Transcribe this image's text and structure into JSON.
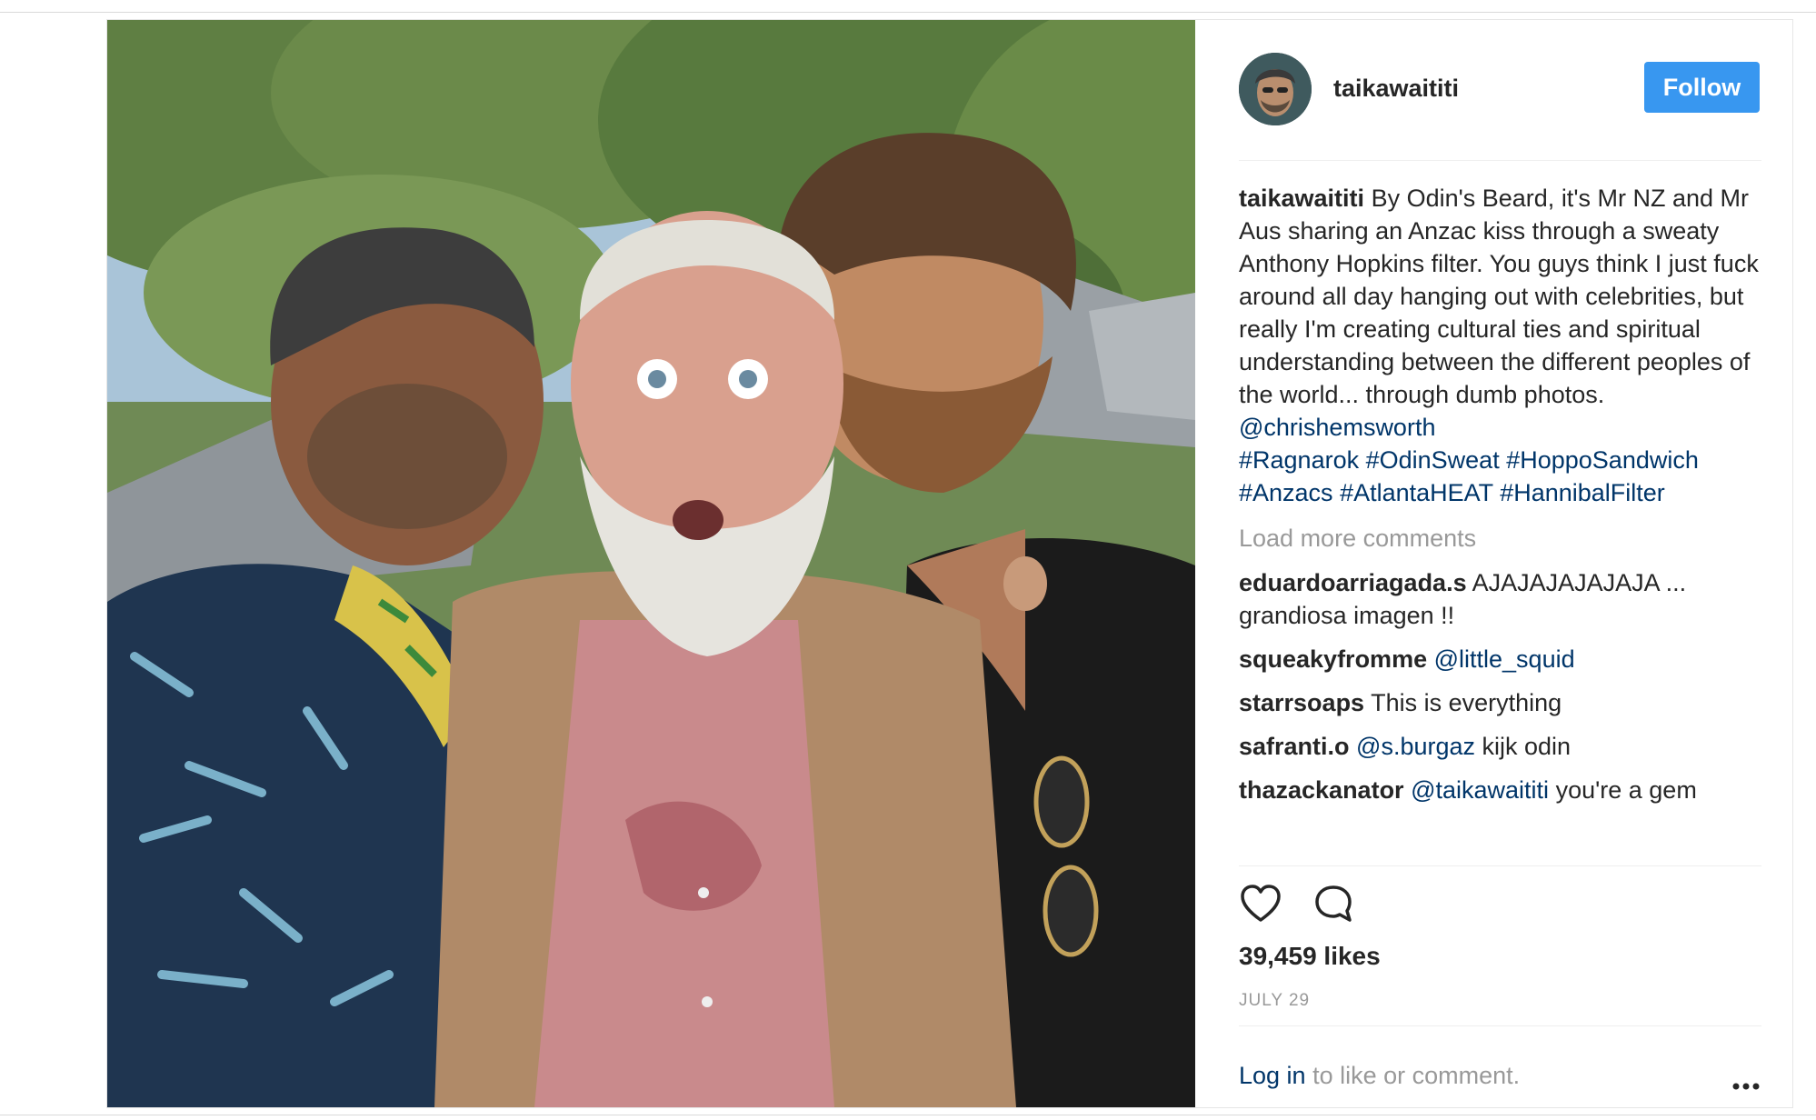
{
  "post": {
    "username": "taikawaititi",
    "follow_label": "Follow",
    "caption": {
      "username": "taikawaititi",
      "text": "By Odin's Beard, it's Mr NZ and Mr Aus sharing an Anzac kiss through a sweaty Anthony Hopkins filter. You guys think I just fuck around all day hanging out with celebrities, but really I'm creating cultural ties and spiritual understanding between the different peoples of the world... through dumb photos.",
      "mention": "@chrishemsworth",
      "hashtags": [
        "#Ragnarok",
        "#OdinSweat",
        "#HoppoSandwich",
        "#Anzacs",
        "#AtlantaHEAT",
        "#HannibalFilter"
      ]
    },
    "load_more": "Load more comments",
    "comments": [
      {
        "username": "eduardoarriagada.s",
        "mention": "",
        "text": "AJAJAJAJAJAJA ... grandiosa imagen !!"
      },
      {
        "username": "squeakyfromme",
        "mention": "@little_squid",
        "text": ""
      },
      {
        "username": "starrsoaps",
        "mention": "",
        "text": "This is everything"
      },
      {
        "username": "safranti.o",
        "mention": "@s.burgaz",
        "text": "kijk odin"
      },
      {
        "username": "thazackanator",
        "mention": "@taikawaititi",
        "text": "you're a gem"
      }
    ],
    "likes": "39,459 likes",
    "date": "JULY 29",
    "login_link": "Log in",
    "login_suffix": "to like or comment."
  },
  "icons": {
    "like": "heart-icon",
    "comment": "comment-bubble-icon",
    "more": "more-options-icon",
    "avatar": "profile-avatar"
  },
  "colors": {
    "follow_button": "#3897f0",
    "link": "#003569",
    "muted": "#999999",
    "text": "#262626"
  }
}
